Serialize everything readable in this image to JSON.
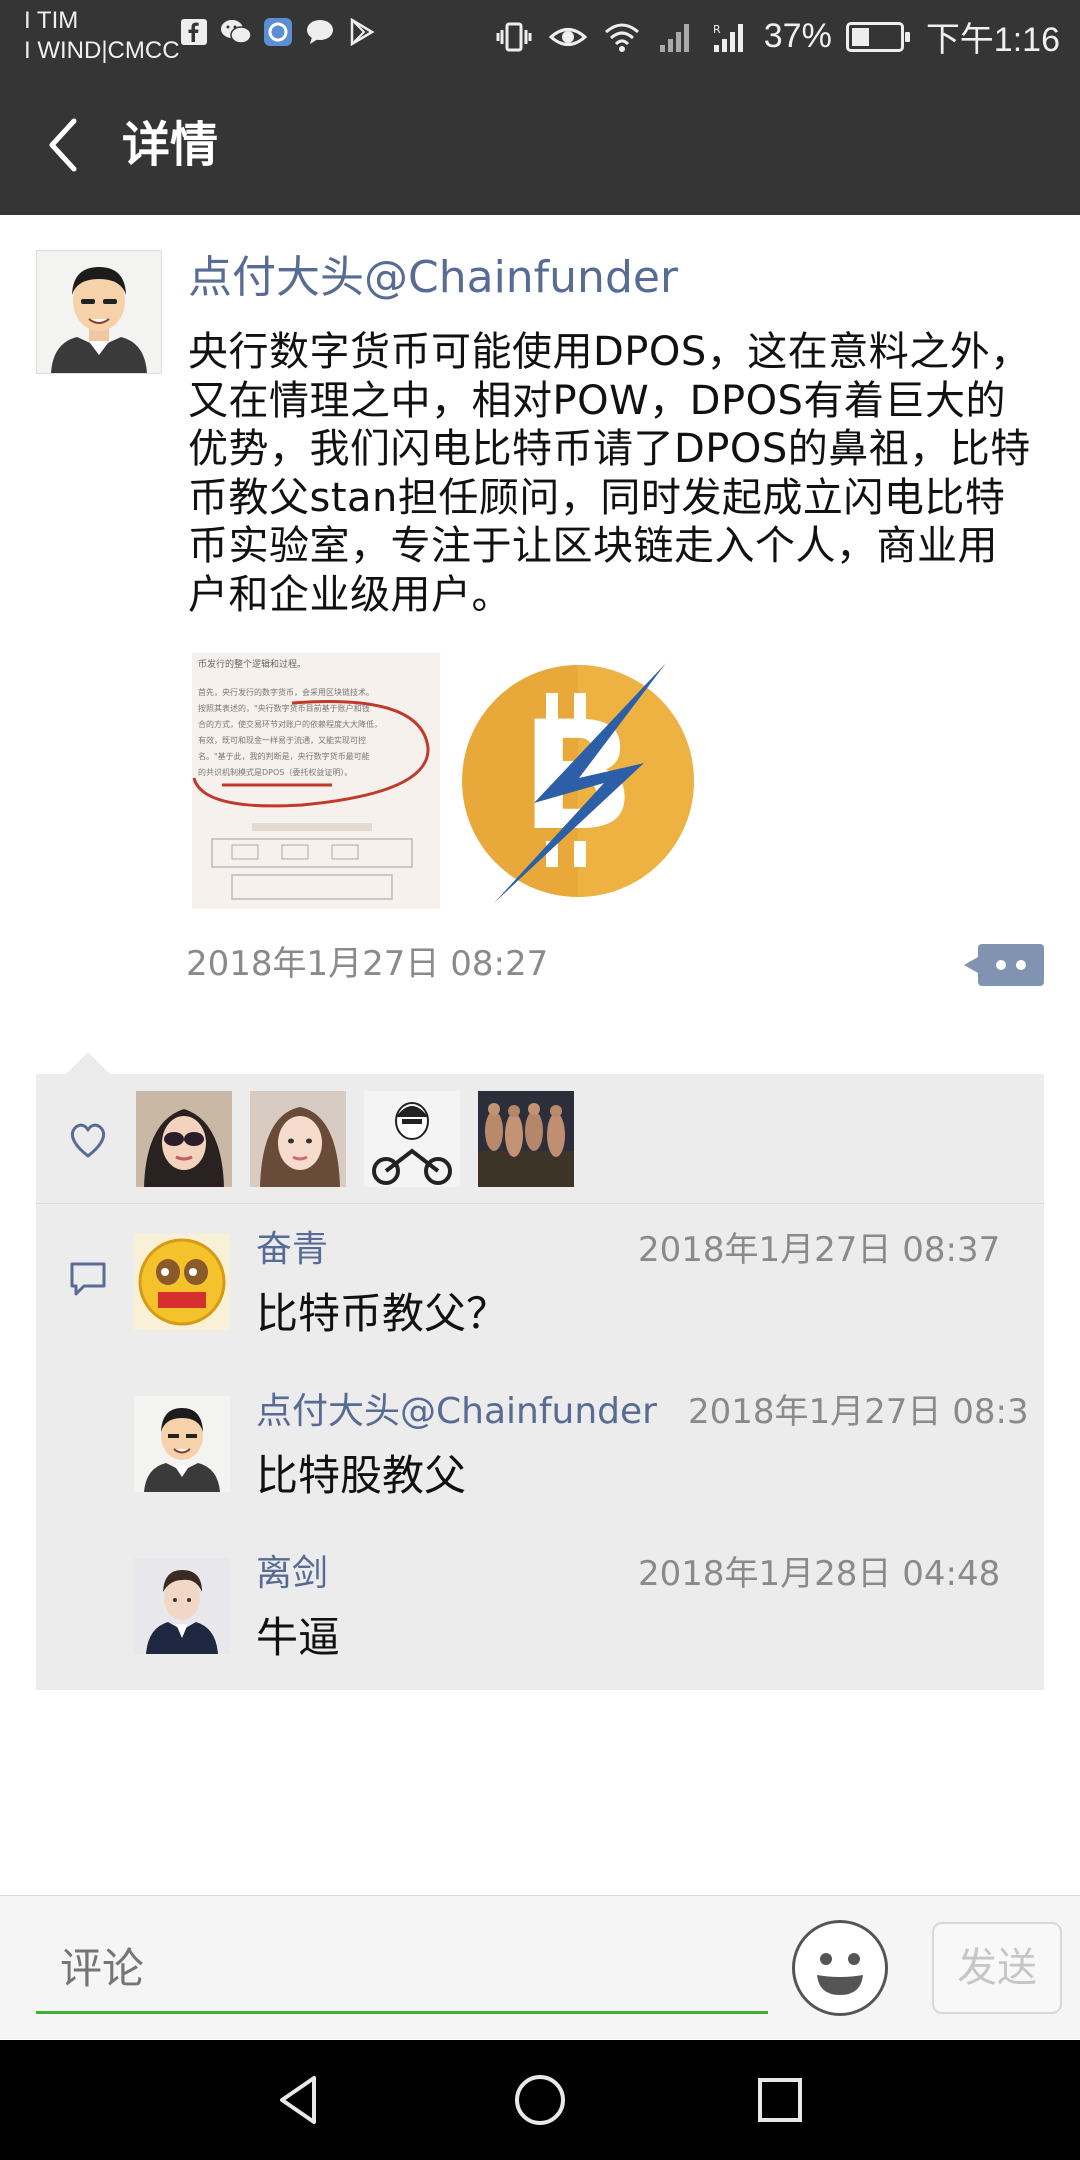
{
  "status_bar": {
    "carrier_line1": "I TIM",
    "carrier_line2": "I WIND|CMCC",
    "battery_text": "37%",
    "battery_level": 0.37,
    "time": "下午1:16"
  },
  "header": {
    "title": "详情"
  },
  "post": {
    "author": "点付大头@Chainfunder",
    "content": "央行数字货币可能使用DPOS，这在意料之外，又在情理之中，相对POW，DPOS有着巨大的优势，我们闪电比特币请了DPOS的鼻祖，比特币教父stan担任顾问，同时发起成立闪电比特币实验室，专注于让区块链走入个人，商业用户和企业级用户。",
    "image1_text": {
      "line1": "币发行的整个逻辑和过程。",
      "line2": "首先，央行发行的数字货币，会采用区块链技术。",
      "line3": "按照其表述的，\"央行数字货币目前基于账户和钱",
      "line4": "合的方式，使交易环节对账户的依赖程度大大降低，",
      "line5": "有效，既可和现金一样易于流通，又能实现可控",
      "line6": "名。\"基于此，我的判断是，央行数字货币最可能",
      "line7": "的共识机制模式是DPOS（委托权益证明）。"
    },
    "time": "2018年1月27日 08:27"
  },
  "likes": {
    "icon": "heart-icon",
    "avatars": [
      "avatar-sunglasses-woman",
      "avatar-young-woman",
      "avatar-cartoon-motorcycle",
      "avatar-group-photo"
    ]
  },
  "comments": [
    {
      "name": "奋青",
      "time": "2018年1月27日 08:37",
      "text": "比特币教父？"
    },
    {
      "name": "点付大头@Chainfunder",
      "time": "2018年1月27日 08:3",
      "text": "比特股教父"
    },
    {
      "name": "离剑",
      "time": "2018年1月28日 04:48",
      "text": "牛逼"
    }
  ],
  "comment_bar": {
    "placeholder": "评论",
    "send_label": "发送"
  },
  "colors": {
    "topbar": "#353535",
    "link_blue": "#576b95",
    "input_underline": "#3cb034"
  }
}
